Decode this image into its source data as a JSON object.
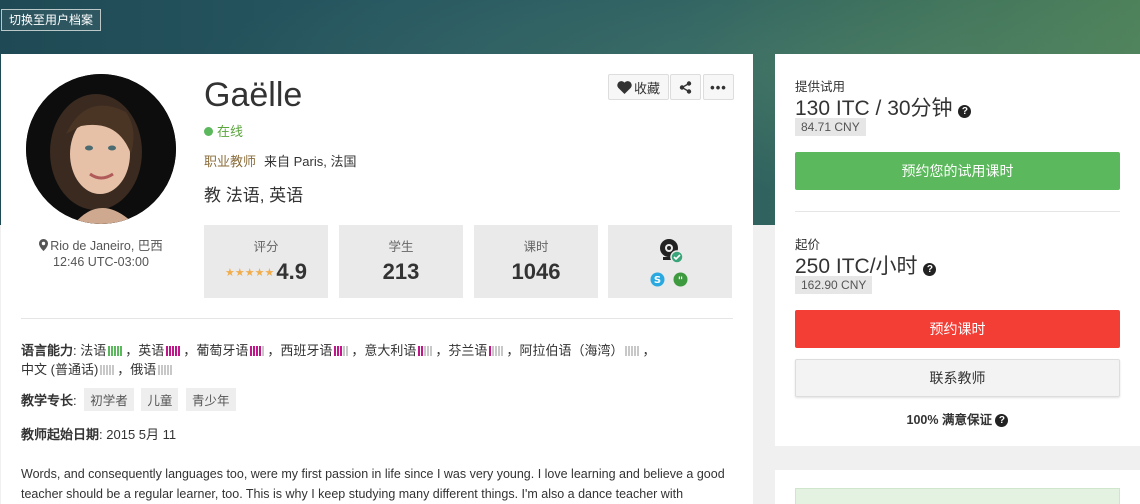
{
  "header": {
    "switch_label": "切换至用户档案"
  },
  "profile": {
    "name": "Gaëlle",
    "status": "在线",
    "role": "职业教师",
    "from": "来自 Paris, 法国",
    "teaches": "教 法语, 英语",
    "location": "Rio de Janeiro, 巴西",
    "local_time": "12:46 UTC-03:00"
  },
  "actions": {
    "favorite_label": "收藏"
  },
  "stats": {
    "rating_label": "评分",
    "rating_value": "4.9",
    "rating_stars": 5,
    "students_label": "学生",
    "students_value": "213",
    "lessons_label": "课时",
    "lessons_value": "1046"
  },
  "languages": {
    "label": "语言能力",
    "line1": [
      {
        "name": "法语",
        "level": 5,
        "color": "#5cb85c",
        "sep": "，"
      },
      {
        "name": "英语",
        "level": 5,
        "color": "#c0168a",
        "sep": "，"
      },
      {
        "name": "葡萄牙语",
        "level": 4,
        "color": "#c0168a",
        "sep": "，"
      },
      {
        "name": "西班牙语",
        "level": 3,
        "color": "#c0168a",
        "sep": "，"
      },
      {
        "name": "意大利语",
        "level": 2,
        "color": "#c0168a",
        "sep": "，"
      },
      {
        "name": "芬兰语",
        "level": 1,
        "color": "#c0168a",
        "sep": "，"
      },
      {
        "name": "阿拉伯语（海湾）",
        "level": 0,
        "color": "#c0168a",
        "sep": "，"
      }
    ],
    "line2": [
      {
        "name": "中文 (普通话)",
        "level": 0,
        "color": "#c0168a",
        "sep": "，"
      },
      {
        "name": "俄语",
        "level": 0,
        "color": "#c0168a",
        "sep": ""
      }
    ]
  },
  "specialty": {
    "label": "教学专长",
    "tags": [
      "初学者",
      "儿童",
      "青少年"
    ]
  },
  "start_date": {
    "label": "教师起始日期",
    "value": "2015 5月 11"
  },
  "about": "Words, and consequently languages too, were my first passion in life since I was very young. I love learning and believe a good teacher should be a regular learner, too. This is why I keep studying many different things. I'm also a dance teacher with",
  "sidebar": {
    "trial_label": "提供试用",
    "trial_price": "130 ITC / 30分钟",
    "trial_cny": "84.71 CNY",
    "trial_button": "预约您的试用课时",
    "from_label": "起价",
    "from_price": "250 ITC/小时",
    "from_cny": "162.90 CNY",
    "book_button": "预约课时",
    "contact_button": "联系教师",
    "guarantee": "100% 满意保证"
  }
}
